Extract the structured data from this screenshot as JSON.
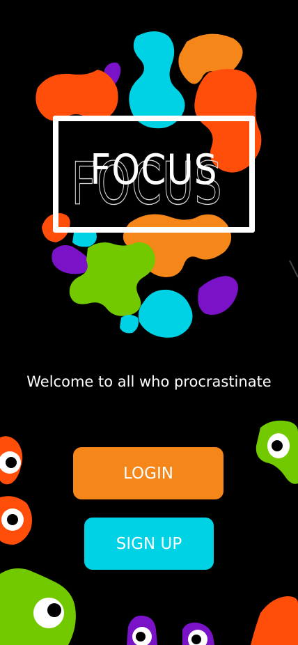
{
  "app": {
    "logo_text": "FOCUS",
    "tagline": "Welcome to all who procrastinate"
  },
  "actions": {
    "login_label": "LOGIN",
    "signup_label": "SIGN UP"
  },
  "colors": {
    "background": "#000000",
    "orange": "#f5861a",
    "red_orange": "#ff4d0a",
    "cyan": "#00d2e6",
    "purple": "#7a12c8",
    "green": "#72c900",
    "white": "#ffffff"
  }
}
